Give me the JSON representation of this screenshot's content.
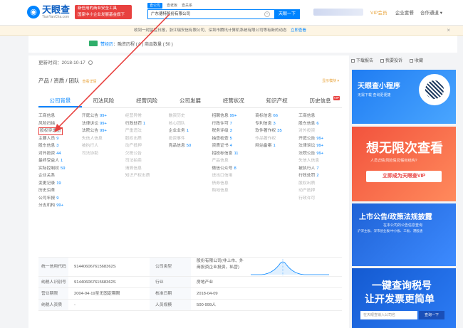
{
  "header": {
    "logo_name": "天眼查",
    "logo_url": "TianYanCha.com",
    "promo_line1": "新任用的商业安全工具",
    "promo_line2": "国家中小企业发展基金旗下",
    "search_tabs": [
      "查公司",
      "查老板",
      "查关系"
    ],
    "search_value": "广东德特股份有限公司",
    "search_button": "天眼一下",
    "vip_label": "VIP会员",
    "links": [
      "企业套餐",
      "合作通道 ▾"
    ]
  },
  "notice": {
    "text": "收到一封监控日报，浙江瑞安信有限公司、深圳市腾讯计算机系统有限公司等有新的动态",
    "link": "立即查看",
    "close": "×"
  },
  "company_strip": {
    "text_hl": "赞经历",
    "text": "：融资历程 ( 0 ) 商品数量 ( 50 )"
  },
  "main": {
    "updated_label": "更新时间：2018-10-17",
    "section_title": "产品 / 资质 / 团队",
    "section_count": "查看详情",
    "show_module": "显示模块 ▾",
    "tabs": [
      "公司背景",
      "司法风险",
      "经营风险",
      "公司发展",
      "经营状况",
      "知识产权",
      "历史信息"
    ],
    "vip_tag": "VIP",
    "columns": [
      [
        {
          "label": "工商信息",
          "num": "",
          "style": ""
        },
        {
          "label": "风险扫描",
          "num": "",
          "style": ""
        },
        {
          "label": "股权穿透图",
          "num": "",
          "style": "boxed"
        },
        {
          "label": "主要人员",
          "num": "9",
          "style": ""
        },
        {
          "label": "股东信息",
          "num": "3",
          "style": ""
        },
        {
          "label": "对外投资",
          "num": "44",
          "style": ""
        },
        {
          "label": "最终受益人",
          "num": "1",
          "style": ""
        },
        {
          "label": "实际控制权",
          "num": "59",
          "style": ""
        },
        {
          "label": "企业关系",
          "num": "",
          "style": ""
        },
        {
          "label": "变更记录",
          "num": "19",
          "style": ""
        },
        {
          "label": "历史沿革",
          "num": "",
          "style": ""
        },
        {
          "label": "公司年报",
          "num": "9",
          "style": ""
        },
        {
          "label": "分支机构",
          "num": "99+",
          "style": ""
        }
      ],
      [
        {
          "label": "开庭公告",
          "num": "99+",
          "style": ""
        },
        {
          "label": "法律诉讼",
          "num": "99+",
          "style": ""
        },
        {
          "label": "法院公告",
          "num": "99+",
          "style": ""
        },
        {
          "label": "失信人信息",
          "num": "",
          "style": "faded"
        },
        {
          "label": "被执行人",
          "num": "",
          "style": "faded"
        },
        {
          "label": "司法协助",
          "num": "",
          "style": "faded"
        },
        {
          "label": "",
          "num": "",
          "style": ""
        },
        {
          "label": "",
          "num": "",
          "style": ""
        }
      ],
      [
        {
          "label": "经营异常",
          "num": "",
          "style": "faded"
        },
        {
          "label": "行政处罚",
          "num": "1",
          "style": ""
        },
        {
          "label": "严重违法",
          "num": "",
          "style": "faded"
        },
        {
          "label": "股权出质",
          "num": "",
          "style": "faded"
        },
        {
          "label": "动产抵押",
          "num": "",
          "style": "faded"
        },
        {
          "label": "欠税公告",
          "num": "",
          "style": "faded"
        },
        {
          "label": "司法拍卖",
          "num": "",
          "style": "faded"
        },
        {
          "label": "清算信息",
          "num": "",
          "style": "faded"
        },
        {
          "label": "知识产权出质",
          "num": "",
          "style": "faded"
        }
      ],
      [
        {
          "label": "融资历史",
          "num": "",
          "style": "faded"
        },
        {
          "label": "核心团队",
          "num": "",
          "style": "faded"
        },
        {
          "label": "企业业务",
          "num": "1",
          "style": ""
        },
        {
          "label": "投资事件",
          "num": "",
          "style": "faded"
        },
        {
          "label": "竞品信息",
          "num": "50",
          "style": ""
        }
      ],
      [
        {
          "label": "招聘信息",
          "num": "99+",
          "style": ""
        },
        {
          "label": "行政许可",
          "num": "7",
          "style": ""
        },
        {
          "label": "税务评级",
          "num": "3",
          "style": ""
        },
        {
          "label": "抽查检查",
          "num": "5",
          "style": ""
        },
        {
          "label": "资质证书",
          "num": "4",
          "style": ""
        },
        {
          "label": "招投标信息",
          "num": "11",
          "style": ""
        },
        {
          "label": "产品信息",
          "num": "",
          "style": "faded"
        },
        {
          "label": "微信公众号",
          "num": "8",
          "style": ""
        },
        {
          "label": "进出口信用",
          "num": "",
          "style": "faded"
        },
        {
          "label": "债券信息",
          "num": "",
          "style": "faded"
        },
        {
          "label": "购地信息",
          "num": "",
          "style": "faded"
        }
      ],
      [
        {
          "label": "商标信息",
          "num": "66",
          "style": ""
        },
        {
          "label": "专利信息",
          "num": "3",
          "style": ""
        },
        {
          "label": "软件著作权",
          "num": "35",
          "style": ""
        },
        {
          "label": "作品著作权",
          "num": "",
          "style": "faded"
        },
        {
          "label": "网站备案",
          "num": "1",
          "style": ""
        }
      ],
      [
        {
          "label": "工商信息",
          "num": "",
          "style": ""
        },
        {
          "label": "股东信息",
          "num": "6",
          "style": ""
        },
        {
          "label": "对外投资",
          "num": "",
          "style": "faded"
        },
        {
          "label": "开庭公告",
          "num": "99+",
          "style": ""
        },
        {
          "label": "法律诉讼",
          "num": "99+",
          "style": ""
        },
        {
          "label": "法院公告",
          "num": "99+",
          "style": ""
        },
        {
          "label": "失信人信息",
          "num": "",
          "style": "faded"
        },
        {
          "label": "被执行人",
          "num": "7",
          "style": ""
        },
        {
          "label": "行政处罚",
          "num": "2",
          "style": ""
        },
        {
          "label": "股权出质",
          "num": "",
          "style": "faded"
        },
        {
          "label": "动产抵押",
          "num": "",
          "style": "faded"
        },
        {
          "label": "行政许可",
          "num": "",
          "style": "faded"
        }
      ]
    ],
    "new_badge": "NEW",
    "info_rows": [
      {
        "k": "统一信用代码",
        "v": "91440606761568362S",
        "k2": "公司类型",
        "v2": "股份有限公司(非上市、外商投资企业投资，私营)"
      },
      {
        "k": "纳税人识别号",
        "v": "91440606761568362S",
        "k2": "行业",
        "v2": "房地产业"
      },
      {
        "k": "营业期限",
        "v": "2004-04-19至无固定期限",
        "k2": "核准日期",
        "v2": "2018-04-09"
      },
      {
        "k": "纳税人资质",
        "v": "-",
        "k2": "人员规模",
        "v2": "500-999人"
      }
    ]
  },
  "right_tools": [
    "下载报告",
    "我要投诉",
    "收藏"
  ],
  "ads": {
    "ad1_title": "天眼查小程序",
    "ad1_sub": "无需下载 查询更便捷",
    "ad2_title": "想无限次查看",
    "ad2_sub": "人员详情/风险情况/股权结构?",
    "ad2_btn": "立即成为天眼查VIP",
    "ad3_title": "上市公告/政策法规披露",
    "ad3_sub": "在本公司的公告信息查询",
    "ad3_sub2": "沪深主板、深市创业板/中小板、三板、港股通",
    "ad4_title1": "一键查询税号",
    "ad4_title2": "让开发票更简单",
    "ad4_input": "在天眼查输入公司名",
    "ad4_btn": "查询一下"
  }
}
